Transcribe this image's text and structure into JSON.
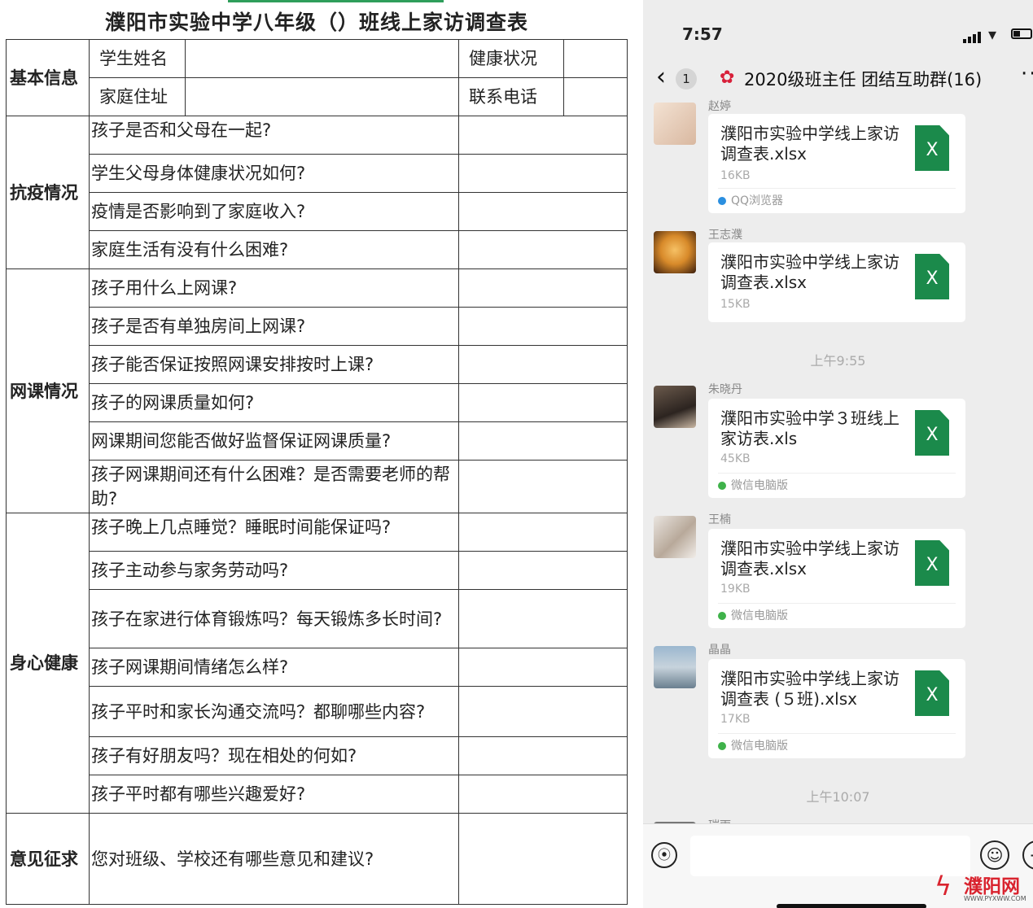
{
  "survey": {
    "title": "濮阳市实验中学八年级（）班线上家访调查表",
    "basic": {
      "category": "基本信息",
      "student_name": "学生姓名",
      "health": "健康状况",
      "address": "家庭住址",
      "phone": "联系电话"
    },
    "sections": [
      {
        "category": "抗疫情况",
        "questions": [
          "孩子是否和父母在一起?",
          "学生父母身体健康状况如何?",
          "疫情是否影响到了家庭收入?",
          "家庭生活有没有什么困难?"
        ]
      },
      {
        "category": "网课情况",
        "questions": [
          "孩子用什么上网课?",
          "孩子是否有单独房间上网课?",
          "孩子能否保证按照网课安排按时上课?",
          "孩子的网课质量如何?",
          "网课期间您能否做好监督保证网课质量?",
          "孩子网课期间还有什么困难？是否需要老师的帮助?"
        ]
      },
      {
        "category": "身心健康",
        "questions": [
          "孩子晚上几点睡觉？睡眠时间能保证吗?",
          "孩子主动参与家务劳动吗?",
          "孩子在家进行体育锻炼吗？每天锻炼多长时间?",
          "孩子网课期间情绪怎么样?",
          "孩子平时和家长沟通交流吗？都聊哪些内容?",
          "孩子有好朋友吗？现在相处的何如?",
          "孩子平时都有哪些兴趣爱好?"
        ]
      },
      {
        "category": "意见征求",
        "questions": [
          "您对班级、学校还有哪些意见和建议?"
        ]
      }
    ]
  },
  "chat": {
    "status_time": "7:57",
    "back_count": "1",
    "group_name": "2020级班主任 团结互助群(16)",
    "timestamps": [
      "上午9:55",
      "上午10:07"
    ],
    "messages": [
      {
        "sender": "赵婷",
        "file": "濮阳市实验中学线上家访调查表.xlsx",
        "size": "16KB",
        "source": "QQ浏览器"
      },
      {
        "sender": "王志濮",
        "file": "濮阳市实验中学线上家访调查表.xlsx",
        "size": "15KB",
        "source": ""
      },
      {
        "sender": "朱晓丹",
        "file": "濮阳市实验中学３班线上家访表.xls",
        "size": "45KB",
        "source": "微信电脑版"
      },
      {
        "sender": "王楠",
        "file": "濮阳市实验中学线上家访调查表.xlsx",
        "size": "19KB",
        "source": "微信电脑版"
      },
      {
        "sender": "晶晶",
        "file": "濮阳市实验中学线上家访调查表 (５班).xlsx",
        "size": "17KB",
        "source": "微信电脑版"
      },
      {
        "sender": "瑞雨"
      }
    ],
    "xls_glyph": "X"
  },
  "watermark": {
    "name": "濮阳网",
    "url": "WWW.PYXWW.COM"
  },
  "colors": {
    "excel_green": "#1b8a4b",
    "chat_bg": "#ededed",
    "watermark_red": "#d9232e"
  },
  "icons": [
    "back-chevron-icon",
    "flower-emoji-icon",
    "more-icon",
    "excel-file-icon",
    "qq-browser-icon",
    "wechat-pc-icon",
    "voice-icon",
    "emoji-icon",
    "plus-icon"
  ]
}
